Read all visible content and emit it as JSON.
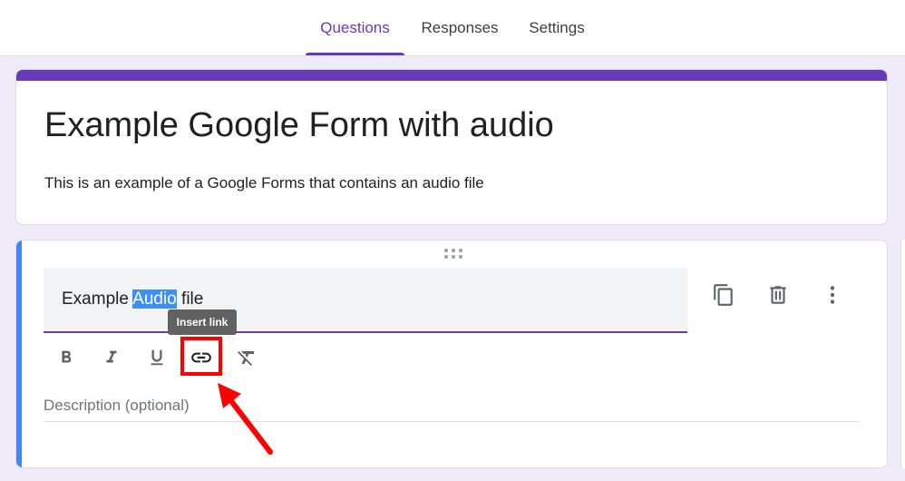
{
  "tabs": [
    {
      "label": "Questions",
      "active": true
    },
    {
      "label": "Responses",
      "active": false
    },
    {
      "label": "Settings",
      "active": false
    }
  ],
  "form": {
    "title": "Example Google Form with audio",
    "description": "This is an example of a Google Forms that contains an audio file"
  },
  "question": {
    "text_before": "Example ",
    "text_selected": "Audio",
    "text_after": " file",
    "description_placeholder": "Description (optional)"
  },
  "toolbar": {
    "bold_icon": "bold-icon",
    "italic_icon": "italic-icon",
    "underline_icon": "underline-icon",
    "link_icon": "link-icon",
    "clear_format_icon": "clear-formatting-icon",
    "tooltip": "Insert link"
  },
  "actions": {
    "duplicate_icon": "copy-icon",
    "delete_icon": "trash-icon",
    "more_icon": "more-vert-icon"
  },
  "colors": {
    "accent": "#673ab7",
    "active_question_border": "#4285f4",
    "background": "#f0ebf8",
    "annotation": "#ff0000",
    "selection": "#3e8ef7"
  }
}
